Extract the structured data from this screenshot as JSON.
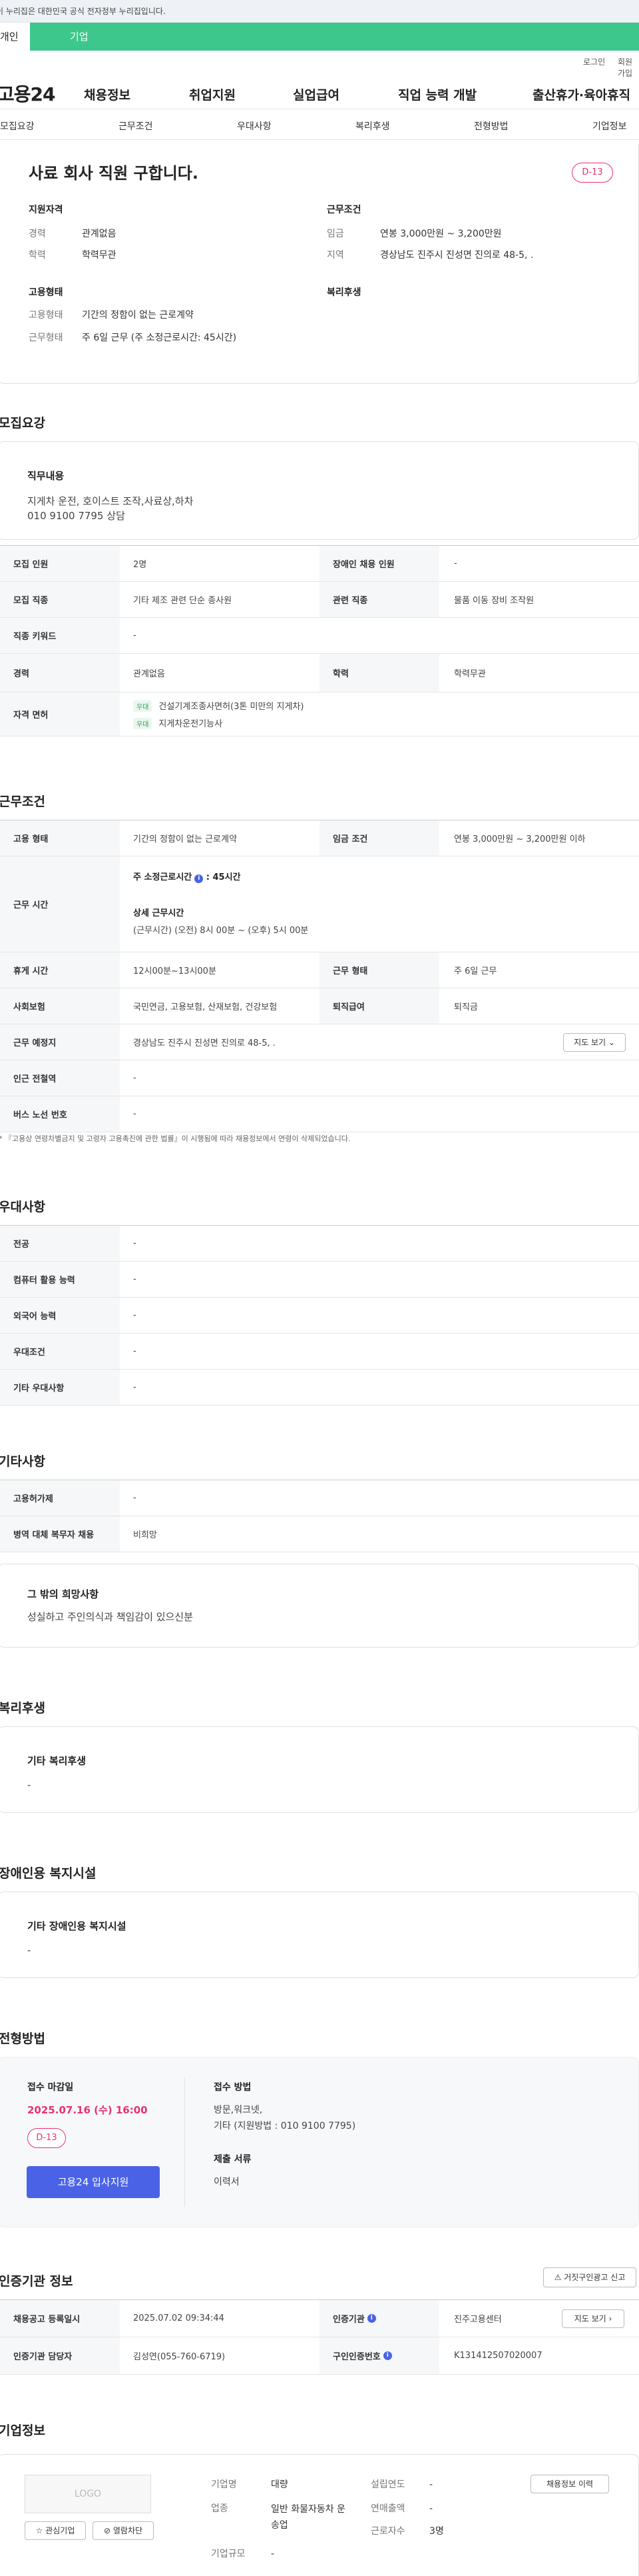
{
  "gov_banner": "이 누리집은 대한민국 공식 전자정부 누리집입니다.",
  "audience_tabs": [
    "개인",
    "기업"
  ],
  "util": {
    "login": "로그인",
    "join": "회원가입"
  },
  "gnb": {
    "logo": "고용24",
    "menu": [
      "채용정보",
      "취업지원",
      "실업급여",
      "직업 능력 개발",
      "출산휴가·육아휴직"
    ]
  },
  "lnb": [
    "모집요강",
    "근무조건",
    "우대사항",
    "복리후생",
    "전형방법",
    "기업정보"
  ],
  "summary": {
    "title": "사료 회사 직원 구합니다.",
    "dday": "D-13",
    "qual_title": "지원자격",
    "qual": [
      {
        "k": "경력",
        "v": "관계없음"
      },
      {
        "k": "학력",
        "v": "학력무관"
      }
    ],
    "cond_title": "근무조건",
    "cond": [
      {
        "k": "임금",
        "v": "연봉 3,000만원 ~ 3,200만원"
      },
      {
        "k": "지역",
        "v": "경상남도 진주시 진성면 진의로 48-5, ."
      }
    ],
    "emp_title": "고용형태",
    "emp": [
      {
        "k": "고용형태",
        "v": "기간의 정함이 없는 근로계약"
      },
      {
        "k": "근무형태",
        "v": "주 6일 근무 (주 소정근로시간: 45시간)"
      }
    ],
    "welfare_title": "복리후생"
  },
  "recruit": {
    "section_title": "모집요강",
    "duty_title": "직무내용",
    "duty_lines": [
      "지게차 운전, 호이스트 조작,사료상,하차",
      "010 9100 7795 상담"
    ],
    "rows": [
      {
        "k": "모집 인원",
        "v": "2명",
        "k2": "장애인 채용 인원",
        "v2": "-"
      },
      {
        "k": "모집 직종",
        "v": "기타 제조 관련 단순 종사원",
        "k2": "관련 직종",
        "v2": "물품 이동 장비 조작원"
      },
      {
        "k": "직종 키워드",
        "v": "-"
      },
      {
        "k": "경력",
        "v": "관계없음",
        "k2": "학력",
        "v2": "학력무관"
      }
    ],
    "license_label": "자격 면허",
    "licenses": [
      {
        "tag": "우대",
        "name": "건설기계조종사면허(3톤 미만의 지게차)"
      },
      {
        "tag": "우대",
        "name": "지게차운전기능사"
      }
    ]
  },
  "work": {
    "section_title": "근무조건",
    "rows": [
      {
        "k": "고용 형태",
        "v": "기간의 정함이 없는 근로계약",
        "k2": "임금 조건",
        "v2": "연봉 3,000만원 ~ 3,200만원 이하"
      }
    ],
    "hours_label": "근무 시간",
    "hours_main": "주 소정근로시간",
    "hours_value": ": 45시간",
    "hours_detail_title": "상세 근무시간",
    "hours_detail": "(근무시간) (오전) 8시 00분 ~ (오후) 5시 00분",
    "rows2": [
      {
        "k": "휴게 시간",
        "v": "12시00분~13시00분",
        "k2": "근무 형태",
        "v2": "주 6일 근무"
      },
      {
        "k": "사회보험",
        "v": "국민연금, 고용보험, 산재보험, 건강보험",
        "k2": "퇴직급여",
        "v2": "퇴직금"
      }
    ],
    "place_label": "근무 예정지",
    "place_value": "경상남도 진주시 진성면 진의로 48-5, .",
    "map_btn": "지도 보기",
    "rows3": [
      {
        "k": "인근 전철역",
        "v": "-"
      },
      {
        "k": "버스 노선 번호",
        "v": "-"
      }
    ],
    "note": "* 『고용상 연령차별금지 및 고령자 고용촉진에 관한 법률』이 시행됨에 따라 채용정보에서 연령이 삭제되었습니다."
  },
  "pref": {
    "section_title": "우대사항",
    "rows": [
      {
        "k": "전공",
        "v": "-"
      },
      {
        "k": "컴퓨터 활용 능력",
        "v": "-"
      },
      {
        "k": "외국어 능력",
        "v": "-"
      },
      {
        "k": "우대조건",
        "v": "-"
      },
      {
        "k": "기타 우대사항",
        "v": "-"
      }
    ]
  },
  "etc": {
    "section_title": "기타사항",
    "rows": [
      {
        "k": "고용허가제",
        "v": "-"
      },
      {
        "k": "병역 대체 복무자 채용",
        "v": "비희망"
      }
    ],
    "other_title": "그 밖의 희망사항",
    "other_text": "성실하고 주인의식과 책임감이 있으신분"
  },
  "welfare": {
    "section_title": "복리후생",
    "box_title": "기타 복리후생",
    "box_value": "-"
  },
  "disability": {
    "section_title": "장애인용 복지시설",
    "box_title": "기타 장애인용 복지시설",
    "box_value": "-"
  },
  "selection": {
    "section_title": "전형방법",
    "deadline_label": "접수 마감일",
    "deadline": "2025.07.16 (수) 16:00",
    "dday": "D-13",
    "apply_btn": "고용24 입사지원",
    "method_label": "접수 방법",
    "method_lines": [
      "방문,워크넷,",
      "기타 (지원방법 : 010 9100 7795)"
    ],
    "docs_label": "제출 서류",
    "docs": "이력서"
  },
  "agency": {
    "section_title": "인증기관 정보",
    "report_btn": "거짓구인광고 신고",
    "rows": [
      {
        "k": "채용공고 등록일시",
        "v": "2025.07.02 09:34:44",
        "k2": "인증기관",
        "v2": "진주고용센터"
      },
      {
        "k": "인증기관 담당자",
        "v": "김성연(055-760-6719)",
        "k2": "구인인증번호",
        "v2": "K131412507020007"
      }
    ],
    "map_btn": "지도 보기"
  },
  "company": {
    "section_title": "기업정보",
    "logo_text": "LOGO",
    "fav_btn": "관심기업",
    "block_btn": "열람차단",
    "fields": [
      {
        "k": "기업명",
        "v": "대량"
      },
      {
        "k": "업종",
        "v": "일반 화물자동차 운송업"
      },
      {
        "k": "기업규모",
        "v": "-"
      }
    ],
    "fields2": [
      {
        "k": "설립연도",
        "v": "-"
      },
      {
        "k": "연매출액",
        "v": "-"
      },
      {
        "k": "근로자수",
        "v": "3명"
      }
    ],
    "history_btn": "채용정보 이력"
  }
}
